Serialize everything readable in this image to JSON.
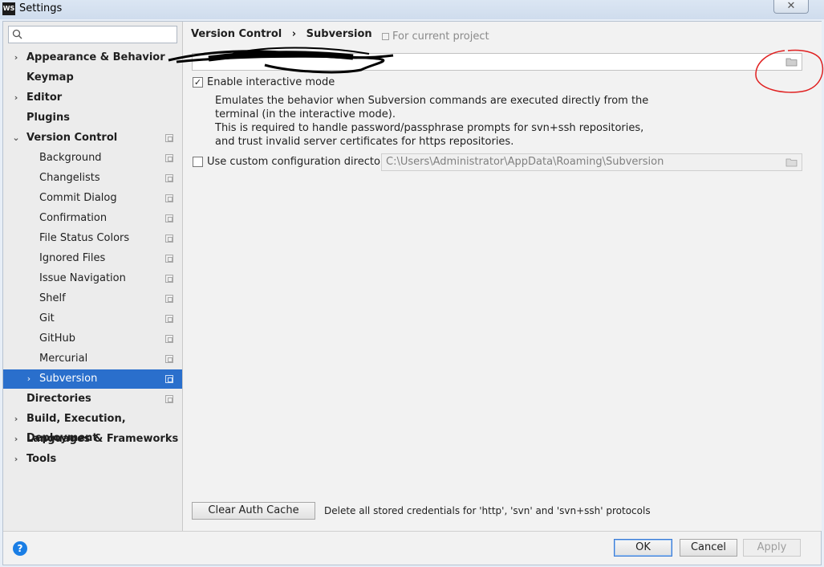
{
  "window": {
    "title": "Settings",
    "app_icon_text": "WS",
    "close_glyph": "✕"
  },
  "search": {
    "placeholder": "",
    "icon": "search-icon"
  },
  "sidebar": {
    "items": [
      {
        "label": "Appearance & Behavior",
        "bold": true,
        "arrow": "›",
        "project": false
      },
      {
        "label": "Keymap",
        "bold": true,
        "arrow": "",
        "project": false
      },
      {
        "label": "Editor",
        "bold": true,
        "arrow": "›",
        "project": false
      },
      {
        "label": "Plugins",
        "bold": true,
        "arrow": "",
        "project": false
      },
      {
        "label": "Version Control",
        "bold": true,
        "arrow": "⌄",
        "project": true
      },
      {
        "label": "Background",
        "bold": false,
        "arrow": "",
        "project": true
      },
      {
        "label": "Changelists",
        "bold": false,
        "arrow": "",
        "project": true
      },
      {
        "label": "Commit Dialog",
        "bold": false,
        "arrow": "",
        "project": true
      },
      {
        "label": "Confirmation",
        "bold": false,
        "arrow": "",
        "project": true
      },
      {
        "label": "File Status Colors",
        "bold": false,
        "arrow": "",
        "project": true
      },
      {
        "label": "Ignored Files",
        "bold": false,
        "arrow": "",
        "project": true
      },
      {
        "label": "Issue Navigation",
        "bold": false,
        "arrow": "",
        "project": true
      },
      {
        "label": "Shelf",
        "bold": false,
        "arrow": "",
        "project": true
      },
      {
        "label": "Git",
        "bold": false,
        "arrow": "",
        "project": true
      },
      {
        "label": "GitHub",
        "bold": false,
        "arrow": "",
        "project": true
      },
      {
        "label": "Mercurial",
        "bold": false,
        "arrow": "",
        "project": true
      },
      {
        "label": "Subversion",
        "bold": false,
        "arrow": "›",
        "project": true,
        "selected": true
      },
      {
        "label": "Directories",
        "bold": true,
        "arrow": "",
        "project": true
      },
      {
        "label": "Build, Execution, Deployment",
        "bold": true,
        "arrow": "›",
        "project": false
      },
      {
        "label": "Languages & Frameworks",
        "bold": true,
        "arrow": "›",
        "project": false
      },
      {
        "label": "Tools",
        "bold": true,
        "arrow": "›",
        "project": false
      }
    ]
  },
  "main": {
    "breadcrumb": [
      "Version Control",
      "›",
      "Subversion"
    ],
    "for_project": "For current project",
    "enable_interactive": {
      "label": "Enable interactive mode",
      "checked": true
    },
    "description": [
      "Emulates the behavior when Subversion commands are executed directly from the",
      "terminal (in the interactive mode).",
      "This is required to handle password/passphrase prompts for svn+ssh repositories,",
      "and trust invalid server certificates for https repositories."
    ],
    "custom_config": {
      "label": "Use custom configuration directory:",
      "checked": false,
      "value": "C:\\Users\\Administrator\\AppData\\Roaming\\Subversion"
    },
    "clear_auth": {
      "button": "Clear Auth Cache",
      "description": "Delete all stored credentials for 'http', 'svn' and 'svn+ssh' protocols"
    }
  },
  "footer": {
    "help": "?",
    "ok": "OK",
    "cancel": "Cancel",
    "apply": "Apply"
  },
  "colors": {
    "selection": "#2a6fcc",
    "annotation": "#e02020",
    "help": "#1a7ee5"
  }
}
